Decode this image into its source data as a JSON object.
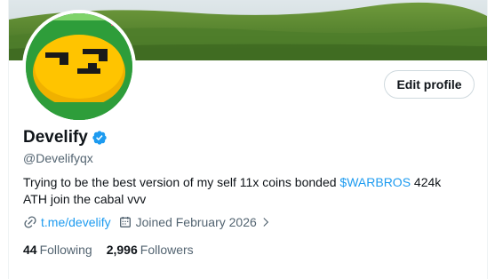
{
  "profile": {
    "display_name": "Develify",
    "handle": "@Develifyqx",
    "verified": true,
    "bio_text": "Trying to be the best version of my self 11x coins bonded ",
    "bio_link": "$WARBROS",
    "bio_after": " 424k ATH join the cabal vvv",
    "website": "t.me/develify",
    "joined": "Joined February 2026",
    "edit_label": "Edit profile"
  },
  "stats": {
    "following_count": "44",
    "following_label": "Following",
    "followers_count": "2,996",
    "followers_label": "Followers"
  },
  "icons": {
    "verified": "verified-badge-icon",
    "link": "link-icon",
    "calendar": "calendar-icon",
    "chevron": "chevron-right-icon"
  },
  "colors": {
    "accent": "#1d9bf0",
    "text": "#0f1419",
    "secondary": "#536471"
  }
}
